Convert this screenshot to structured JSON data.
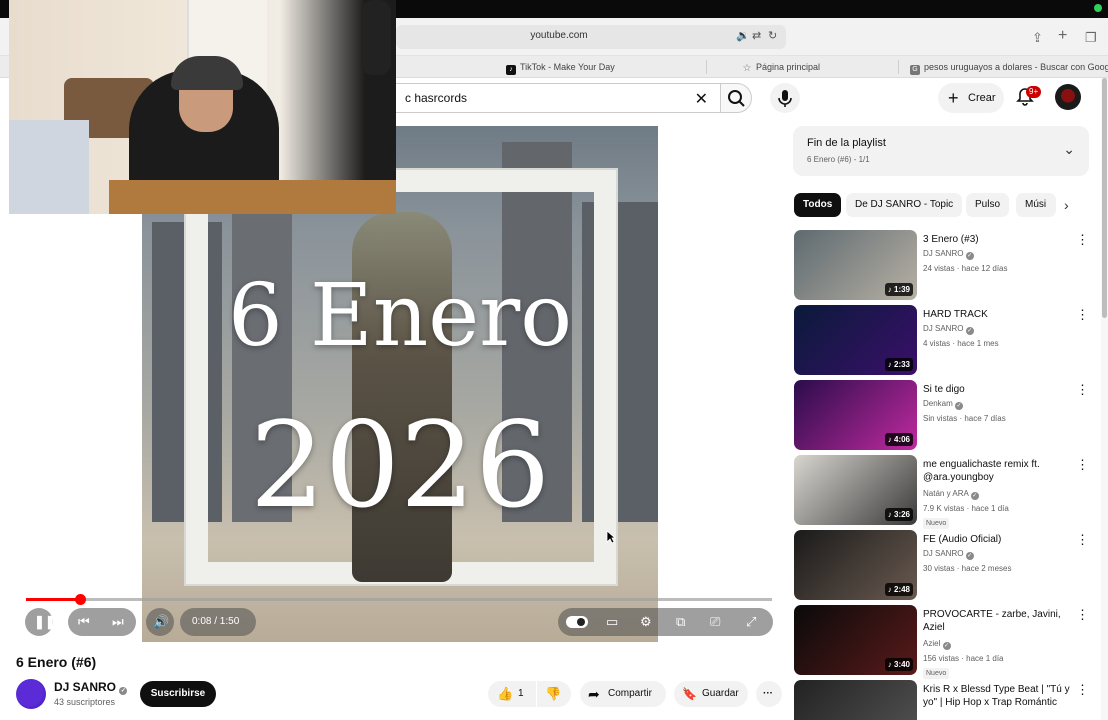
{
  "browser": {
    "url": "youtube.com",
    "tabs": [
      {
        "label": "TikTok - Make Your Day",
        "fav": "♪",
        "color": "#111111"
      },
      {
        "label": "Página principal",
        "fav": "☆",
        "color": "#777777"
      },
      {
        "label": "pesos uruguayos a dolares - Buscar con Google",
        "fav": "G",
        "color": "#666666"
      }
    ]
  },
  "header": {
    "search_query": "c hasrcords",
    "create_label": "Crear",
    "notif_badge": "9+"
  },
  "player": {
    "overlay_line1": "6 Enero",
    "overlay_line2": "2026",
    "time": "0:08 / 1:50",
    "progress": 0.073
  },
  "video": {
    "title": "6 Enero (#6)",
    "channel": "DJ SANRO",
    "subs": "43 suscriptores",
    "subscribe_label": "Suscribirse",
    "likes": "1",
    "share_label": "Compartir",
    "save_label": "Guardar"
  },
  "playlist": {
    "title": "Fin de la playlist",
    "subtitle": "6 Enero (#6) - 1/1"
  },
  "chips": [
    "Todos",
    "De DJ SANRO - Topic",
    "Pulso",
    "Músi"
  ],
  "recommendations": [
    {
      "title": "3 Enero (#3)",
      "channel": "DJ SANRO",
      "meta": "24 vistas · hace 12 días",
      "duration": "1:39",
      "new": "",
      "thumb": [
        "#5e6a70",
        "#b7b0a4"
      ]
    },
    {
      "title": "HARD TRACK",
      "channel": "DJ SANRO",
      "meta": "4 vistas · hace 1 mes",
      "duration": "2:33",
      "new": "",
      "thumb": [
        "#0a1a3a",
        "#3a0f6a"
      ]
    },
    {
      "title": "Si te digo",
      "channel": "Denkam",
      "meta": "Sin vistas · hace 7 días",
      "duration": "4:06",
      "new": "",
      "thumb": [
        "#2a0c4a",
        "#c02aa0"
      ]
    },
    {
      "title": "me engualichaste remix ft. @ara.youngboy",
      "channel": "Natán y ARA",
      "meta": "7.9 K vistas · hace 1 día",
      "duration": "3:26",
      "new": "Nuevo",
      "thumb": [
        "#d9d6d0",
        "#3a3a3a"
      ]
    },
    {
      "title": "FE (Audio Oficial)",
      "channel": "DJ SANRO",
      "meta": "30 vistas · hace 2 meses",
      "duration": "2:48",
      "new": "",
      "thumb": [
        "#1a1a1a",
        "#6a5a50"
      ]
    },
    {
      "title": "PROVOCARTE - zarbe, Javini, Aziel",
      "channel": "Aziel",
      "meta": "156 vistas · hace 1 día",
      "duration": "3:40",
      "new": "Nuevo",
      "thumb": [
        "#0a0a0a",
        "#5a1a1a"
      ]
    },
    {
      "title": "Kris R x Blessd Type Beat | \"Tú y yo\" | Hip Hop x Trap Romántic",
      "channel": "",
      "meta": "",
      "duration": "",
      "new": "",
      "thumb": [
        "#222222",
        "#555555"
      ]
    }
  ]
}
